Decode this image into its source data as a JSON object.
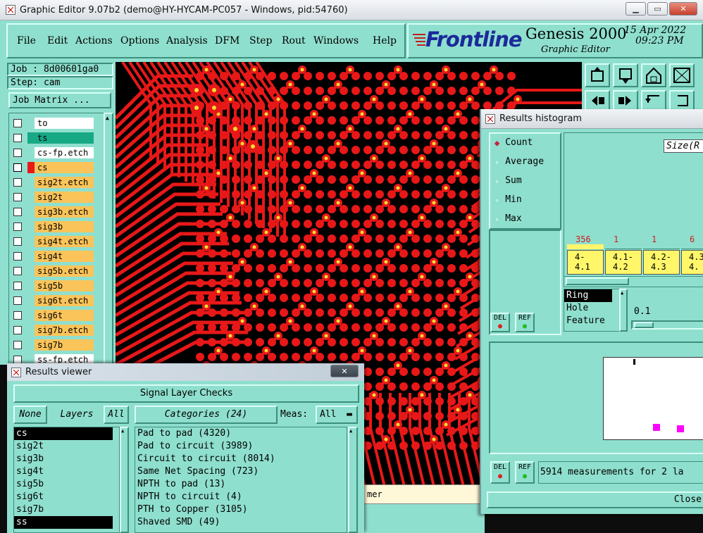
{
  "window": {
    "title": "Graphic Editor 9.07b2 (demo@HY-HYCAM-PC057 - Windows, pid:54760)"
  },
  "menu": [
    "File",
    "Edit",
    "Actions",
    "Options",
    "Analysis",
    "DFM",
    "Step",
    "Rout",
    "Windows",
    "Help"
  ],
  "brand": {
    "logo": "Frontline",
    "product": "Genesis 2000",
    "subtitle": "Graphic Editor",
    "date": "15 Apr 2022",
    "time": "09:23 PM"
  },
  "job": {
    "job_label": "Job : 8d00601ga0",
    "step_label": "Step: cam",
    "matrix_button": "Job Matrix ..."
  },
  "layers": [
    {
      "name": "to",
      "style": "white"
    },
    {
      "name": "ts",
      "style": "green"
    },
    {
      "name": "cs-fp.etch",
      "style": "white"
    },
    {
      "name": "cs",
      "style": "orange",
      "active": true
    },
    {
      "name": "sig2t.etch",
      "style": "orange"
    },
    {
      "name": "sig2t",
      "style": "orange"
    },
    {
      "name": "sig3b.etch",
      "style": "orange"
    },
    {
      "name": "sig3b",
      "style": "orange"
    },
    {
      "name": "sig4t.etch",
      "style": "orange"
    },
    {
      "name": "sig4t",
      "style": "orange"
    },
    {
      "name": "sig5b.etch",
      "style": "orange"
    },
    {
      "name": "sig5b",
      "style": "orange"
    },
    {
      "name": "sig6t.etch",
      "style": "orange"
    },
    {
      "name": "sig6t",
      "style": "orange"
    },
    {
      "name": "sig7b.etch",
      "style": "orange"
    },
    {
      "name": "sig7b",
      "style": "orange"
    },
    {
      "name": "ss-fp.etch",
      "style": "white"
    }
  ],
  "status_fragment": "mer",
  "results_viewer": {
    "title": "Results viewer",
    "header": "Signal Layer Checks",
    "none_button": "None",
    "layers_label": "Layers",
    "all_button": "All",
    "categories_label": "Categories (24)",
    "meas_label": "Meas:",
    "meas_value": "All",
    "layer_list": [
      "cs",
      "sig2t",
      "sig3b",
      "sig4t",
      "sig5b",
      "sig6t",
      "sig7b",
      "ss"
    ],
    "categories": [
      "Pad to pad (4320)",
      "Pad to circuit (3989)",
      "Circuit to circuit (8014)",
      "Same Net Spacing (723)",
      "NPTH to pad (13)",
      "NPTH to circuit (4)",
      "PTH to Copper (3105)",
      "Shaved SMD (49)"
    ]
  },
  "histogram": {
    "title": "Results histogram",
    "modes": [
      "Count",
      "Average",
      "Sum",
      "Min",
      "Max"
    ],
    "size_label": "Size(R",
    "bins": [
      {
        "count": "356",
        "range": "4-\n4.1"
      },
      {
        "count": "1",
        "range": "4.1-\n4.2"
      },
      {
        "count": "1",
        "range": "4.2-\n4.3"
      },
      {
        "count": "6",
        "range": "4.3\n4."
      }
    ],
    "attributes": [
      "Ring",
      "Hole",
      "Feature"
    ],
    "value": "0.1",
    "del_label": "DEL",
    "ref_label": "REF",
    "measurements": "5914 measurements for 2 la",
    "close": "Close"
  },
  "colors": {
    "panel": "#8fdfce",
    "copper": "#e81818",
    "drill": "#f0dc32",
    "background": "#000000",
    "layer_orange": "#fbc45a",
    "layer_green": "#17a884"
  }
}
